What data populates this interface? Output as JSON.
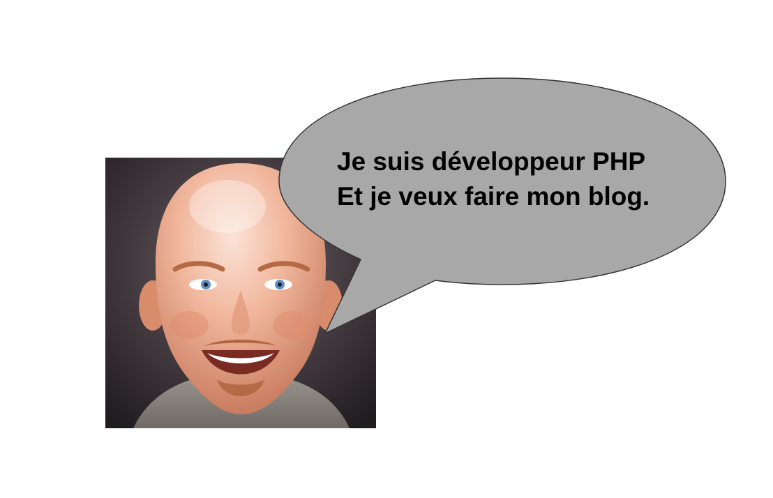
{
  "speech_bubble": {
    "line1": "Je suis développeur PHP",
    "line2": "Et je veux faire mon blog.",
    "fill_color": "#a8a8a8",
    "stroke_color": "#333333"
  },
  "portrait": {
    "subject": "smiling bald man with goatee",
    "skin_color": "#e8a98c",
    "background_color": "#3a3438"
  }
}
